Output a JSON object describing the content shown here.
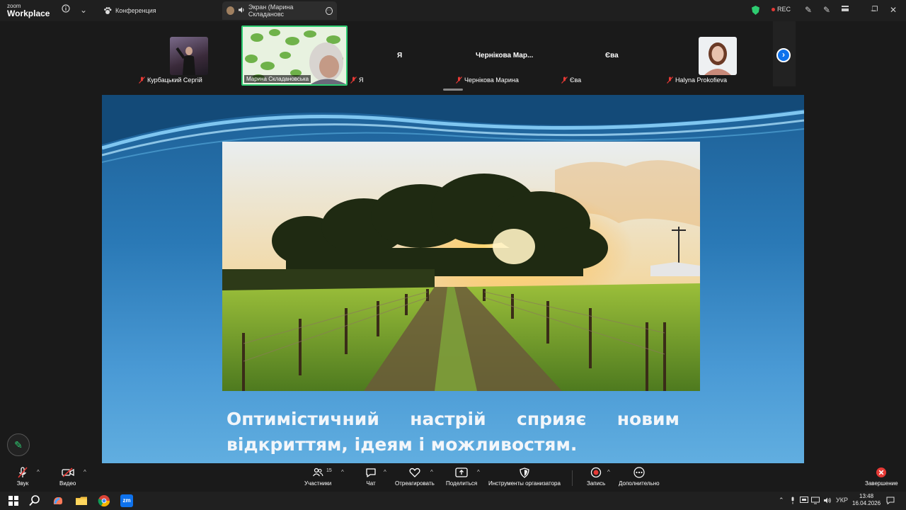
{
  "window": {
    "logo_top": "zoom",
    "logo_bottom": "Workplace",
    "tab_meeting": "Конференция",
    "tab_screen": "Экран (Марина Складановс",
    "rec_label": "REC"
  },
  "gallery": {
    "participants": [
      {
        "name": "Курбацький Сергій",
        "muted": true
      },
      {
        "name": "Марина Складановська",
        "muted": false
      },
      {
        "name": "Я",
        "muted": true
      },
      {
        "name": "Чернікова Марина",
        "muted": true,
        "tile_label": "Чернікова Мар..."
      },
      {
        "name": "Єва",
        "muted": true
      },
      {
        "name": "Halyna Prokofieva",
        "muted": true
      }
    ],
    "self_tile_label": "Я",
    "eva_tile_label": "Єва"
  },
  "slide": {
    "text": "Оптимістичний настрій сприяє новим відкриттям, ідеям і можливостям."
  },
  "toolbar": {
    "audio": "Звук",
    "video": "Видео",
    "participants": "Участники",
    "participants_count": "15",
    "chat": "Чат",
    "react": "Отреагировать",
    "share": "Поделиться",
    "host_tools": "Инструменты организатора",
    "record": "Запись",
    "more": "Дополнительно",
    "end": "Завершение"
  },
  "taskbar": {
    "lang": "УКР",
    "time": "13:48",
    "date": "16.04.2026"
  },
  "colors": {
    "accent": "#0e72ed",
    "muted_red": "#e53935",
    "shield_green": "#2ecc71",
    "active_speaker": "#2ecc71"
  }
}
